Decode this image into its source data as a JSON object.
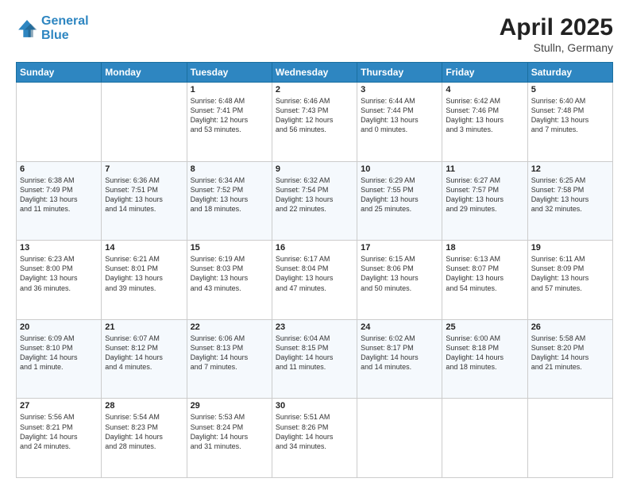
{
  "header": {
    "logo_line1": "General",
    "logo_line2": "Blue",
    "month_year": "April 2025",
    "location": "Stulln, Germany"
  },
  "weekdays": [
    "Sunday",
    "Monday",
    "Tuesday",
    "Wednesday",
    "Thursday",
    "Friday",
    "Saturday"
  ],
  "weeks": [
    [
      {
        "day": "",
        "info": ""
      },
      {
        "day": "",
        "info": ""
      },
      {
        "day": "1",
        "info": "Sunrise: 6:48 AM\nSunset: 7:41 PM\nDaylight: 12 hours\nand 53 minutes."
      },
      {
        "day": "2",
        "info": "Sunrise: 6:46 AM\nSunset: 7:43 PM\nDaylight: 12 hours\nand 56 minutes."
      },
      {
        "day": "3",
        "info": "Sunrise: 6:44 AM\nSunset: 7:44 PM\nDaylight: 13 hours\nand 0 minutes."
      },
      {
        "day": "4",
        "info": "Sunrise: 6:42 AM\nSunset: 7:46 PM\nDaylight: 13 hours\nand 3 minutes."
      },
      {
        "day": "5",
        "info": "Sunrise: 6:40 AM\nSunset: 7:48 PM\nDaylight: 13 hours\nand 7 minutes."
      }
    ],
    [
      {
        "day": "6",
        "info": "Sunrise: 6:38 AM\nSunset: 7:49 PM\nDaylight: 13 hours\nand 11 minutes."
      },
      {
        "day": "7",
        "info": "Sunrise: 6:36 AM\nSunset: 7:51 PM\nDaylight: 13 hours\nand 14 minutes."
      },
      {
        "day": "8",
        "info": "Sunrise: 6:34 AM\nSunset: 7:52 PM\nDaylight: 13 hours\nand 18 minutes."
      },
      {
        "day": "9",
        "info": "Sunrise: 6:32 AM\nSunset: 7:54 PM\nDaylight: 13 hours\nand 22 minutes."
      },
      {
        "day": "10",
        "info": "Sunrise: 6:29 AM\nSunset: 7:55 PM\nDaylight: 13 hours\nand 25 minutes."
      },
      {
        "day": "11",
        "info": "Sunrise: 6:27 AM\nSunset: 7:57 PM\nDaylight: 13 hours\nand 29 minutes."
      },
      {
        "day": "12",
        "info": "Sunrise: 6:25 AM\nSunset: 7:58 PM\nDaylight: 13 hours\nand 32 minutes."
      }
    ],
    [
      {
        "day": "13",
        "info": "Sunrise: 6:23 AM\nSunset: 8:00 PM\nDaylight: 13 hours\nand 36 minutes."
      },
      {
        "day": "14",
        "info": "Sunrise: 6:21 AM\nSunset: 8:01 PM\nDaylight: 13 hours\nand 39 minutes."
      },
      {
        "day": "15",
        "info": "Sunrise: 6:19 AM\nSunset: 8:03 PM\nDaylight: 13 hours\nand 43 minutes."
      },
      {
        "day": "16",
        "info": "Sunrise: 6:17 AM\nSunset: 8:04 PM\nDaylight: 13 hours\nand 47 minutes."
      },
      {
        "day": "17",
        "info": "Sunrise: 6:15 AM\nSunset: 8:06 PM\nDaylight: 13 hours\nand 50 minutes."
      },
      {
        "day": "18",
        "info": "Sunrise: 6:13 AM\nSunset: 8:07 PM\nDaylight: 13 hours\nand 54 minutes."
      },
      {
        "day": "19",
        "info": "Sunrise: 6:11 AM\nSunset: 8:09 PM\nDaylight: 13 hours\nand 57 minutes."
      }
    ],
    [
      {
        "day": "20",
        "info": "Sunrise: 6:09 AM\nSunset: 8:10 PM\nDaylight: 14 hours\nand 1 minute."
      },
      {
        "day": "21",
        "info": "Sunrise: 6:07 AM\nSunset: 8:12 PM\nDaylight: 14 hours\nand 4 minutes."
      },
      {
        "day": "22",
        "info": "Sunrise: 6:06 AM\nSunset: 8:13 PM\nDaylight: 14 hours\nand 7 minutes."
      },
      {
        "day": "23",
        "info": "Sunrise: 6:04 AM\nSunset: 8:15 PM\nDaylight: 14 hours\nand 11 minutes."
      },
      {
        "day": "24",
        "info": "Sunrise: 6:02 AM\nSunset: 8:17 PM\nDaylight: 14 hours\nand 14 minutes."
      },
      {
        "day": "25",
        "info": "Sunrise: 6:00 AM\nSunset: 8:18 PM\nDaylight: 14 hours\nand 18 minutes."
      },
      {
        "day": "26",
        "info": "Sunrise: 5:58 AM\nSunset: 8:20 PM\nDaylight: 14 hours\nand 21 minutes."
      }
    ],
    [
      {
        "day": "27",
        "info": "Sunrise: 5:56 AM\nSunset: 8:21 PM\nDaylight: 14 hours\nand 24 minutes."
      },
      {
        "day": "28",
        "info": "Sunrise: 5:54 AM\nSunset: 8:23 PM\nDaylight: 14 hours\nand 28 minutes."
      },
      {
        "day": "29",
        "info": "Sunrise: 5:53 AM\nSunset: 8:24 PM\nDaylight: 14 hours\nand 31 minutes."
      },
      {
        "day": "30",
        "info": "Sunrise: 5:51 AM\nSunset: 8:26 PM\nDaylight: 14 hours\nand 34 minutes."
      },
      {
        "day": "",
        "info": ""
      },
      {
        "day": "",
        "info": ""
      },
      {
        "day": "",
        "info": ""
      }
    ]
  ]
}
